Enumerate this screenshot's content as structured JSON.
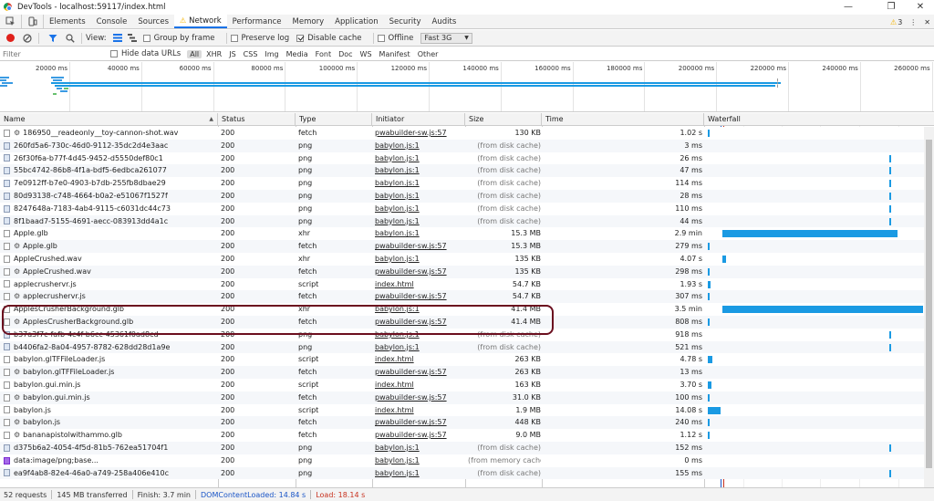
{
  "window": {
    "title": "DevTools - localhost:59117/index.html",
    "controls": [
      "—",
      "❐",
      "✕"
    ]
  },
  "tabs": [
    "Elements",
    "Console",
    "Sources",
    "Network",
    "Performance",
    "Memory",
    "Application",
    "Security",
    "Audits"
  ],
  "active_tab": "Network",
  "issues_count": "3",
  "toolbar": {
    "view_label": "View:",
    "group_by_frame": "Group by frame",
    "preserve_log": "Preserve log",
    "disable_cache": "Disable cache",
    "offline": "Offline",
    "throttle": "Fast 3G"
  },
  "filter": {
    "placeholder": "Filter",
    "hide_data_urls": "Hide data URLs",
    "types": [
      "All",
      "XHR",
      "JS",
      "CSS",
      "Img",
      "Media",
      "Font",
      "Doc",
      "WS",
      "Manifest",
      "Other"
    ]
  },
  "overview_ticks": [
    "20000 ms",
    "40000 ms",
    "60000 ms",
    "80000 ms",
    "100000 ms",
    "120000 ms",
    "140000 ms",
    "160000 ms",
    "180000 ms",
    "200000 ms",
    "220000 ms",
    "240000 ms",
    "260000 ms"
  ],
  "columns": {
    "name": "Name",
    "status": "Status",
    "type": "Type",
    "initiator": "Initiator",
    "size": "Size",
    "time": "Time",
    "waterfall": "Waterfall"
  },
  "rows": [
    {
      "name": "186950__readeonly__toy-cannon-shot.wav",
      "sw": true,
      "icon": "doc",
      "status": "200",
      "type": "fetch",
      "initiator": "pwabuilder-sw.js:57",
      "size": "130 KB",
      "time": "1.02 s"
    },
    {
      "name": "260fd5a6-730c-46d0-9112-35dc2d4e3aac",
      "sw": false,
      "icon": "img",
      "status": "200",
      "type": "png",
      "initiator": "babylon.js:1",
      "size": "(from disk cache)",
      "time": "3 ms"
    },
    {
      "name": "26f30f6a-b77f-4d45-9452-d5550def80c1",
      "sw": false,
      "icon": "img",
      "status": "200",
      "type": "png",
      "initiator": "babylon.js:1",
      "size": "(from disk cache)",
      "time": "26 ms"
    },
    {
      "name": "55bc4742-86b8-4f1a-bdf5-6edbca261077",
      "sw": false,
      "icon": "img",
      "status": "200",
      "type": "png",
      "initiator": "babylon.js:1",
      "size": "(from disk cache)",
      "time": "47 ms"
    },
    {
      "name": "7e0912ff-b7e0-4903-b7db-255fb8dbae29",
      "sw": false,
      "icon": "img",
      "status": "200",
      "type": "png",
      "initiator": "babylon.js:1",
      "size": "(from disk cache)",
      "time": "114 ms"
    },
    {
      "name": "80d93138-c748-4664-b0a2-e51067f1527f",
      "sw": false,
      "icon": "img",
      "status": "200",
      "type": "png",
      "initiator": "babylon.js:1",
      "size": "(from disk cache)",
      "time": "28 ms"
    },
    {
      "name": "8247648a-7183-4ab4-9115-c6031dc44c73",
      "sw": false,
      "icon": "img",
      "status": "200",
      "type": "png",
      "initiator": "babylon.js:1",
      "size": "(from disk cache)",
      "time": "110 ms"
    },
    {
      "name": "8f1baad7-5155-4691-aecc-083913dd4a1c",
      "sw": false,
      "icon": "img",
      "status": "200",
      "type": "png",
      "initiator": "babylon.js:1",
      "size": "(from disk cache)",
      "time": "44 ms"
    },
    {
      "name": "Apple.glb",
      "sw": false,
      "icon": "doc",
      "status": "200",
      "type": "xhr",
      "initiator": "babylon.js:1",
      "size": "15.3 MB",
      "time": "2.9 min"
    },
    {
      "name": "Apple.glb",
      "sw": true,
      "icon": "doc",
      "status": "200",
      "type": "fetch",
      "initiator": "pwabuilder-sw.js:57",
      "size": "15.3 MB",
      "time": "279 ms"
    },
    {
      "name": "AppleCrushed.wav",
      "sw": false,
      "icon": "doc",
      "status": "200",
      "type": "xhr",
      "initiator": "babylon.js:1",
      "size": "135 KB",
      "time": "4.07 s"
    },
    {
      "name": "AppleCrushed.wav",
      "sw": true,
      "icon": "doc",
      "status": "200",
      "type": "fetch",
      "initiator": "pwabuilder-sw.js:57",
      "size": "135 KB",
      "time": "298 ms"
    },
    {
      "name": "applecrushervr.js",
      "sw": false,
      "icon": "doc",
      "status": "200",
      "type": "script",
      "initiator": "index.html",
      "size": "54.7 KB",
      "time": "1.93 s"
    },
    {
      "name": "applecrushervr.js",
      "sw": true,
      "icon": "doc",
      "status": "200",
      "type": "fetch",
      "initiator": "pwabuilder-sw.js:57",
      "size": "54.7 KB",
      "time": "307 ms"
    },
    {
      "name": "ApplesCrusherBackground.glb",
      "sw": false,
      "icon": "doc",
      "status": "200",
      "type": "xhr",
      "initiator": "babylon.js:1",
      "size": "41.4 MB",
      "time": "3.5 min"
    },
    {
      "name": "ApplesCrusherBackground.glb",
      "sw": true,
      "icon": "doc",
      "status": "200",
      "type": "fetch",
      "initiator": "pwabuilder-sw.js:57",
      "size": "41.4 MB",
      "time": "808 ms"
    },
    {
      "name": "b37a3f7c-fafb-4c4f-b6cc-45361f0ad8cd",
      "sw": false,
      "icon": "img",
      "status": "200",
      "type": "png",
      "initiator": "babylon.js:1",
      "size": "(from disk cache)",
      "time": "918 ms"
    },
    {
      "name": "b4406fa2-8a04-4957-8782-628dd28d1a9e",
      "sw": false,
      "icon": "img",
      "status": "200",
      "type": "png",
      "initiator": "babylon.js:1",
      "size": "(from disk cache)",
      "time": "521 ms"
    },
    {
      "name": "babylon.glTFFileLoader.js",
      "sw": false,
      "icon": "doc",
      "status": "200",
      "type": "script",
      "initiator": "index.html",
      "size": "263 KB",
      "time": "4.78 s"
    },
    {
      "name": "babylon.glTFFileLoader.js",
      "sw": true,
      "icon": "doc",
      "status": "200",
      "type": "fetch",
      "initiator": "pwabuilder-sw.js:57",
      "size": "263 KB",
      "time": "13 ms"
    },
    {
      "name": "babylon.gui.min.js",
      "sw": false,
      "icon": "doc",
      "status": "200",
      "type": "script",
      "initiator": "index.html",
      "size": "163 KB",
      "time": "3.70 s"
    },
    {
      "name": "babylon.gui.min.js",
      "sw": true,
      "icon": "doc",
      "status": "200",
      "type": "fetch",
      "initiator": "pwabuilder-sw.js:57",
      "size": "31.0 KB",
      "time": "100 ms"
    },
    {
      "name": "babylon.js",
      "sw": false,
      "icon": "doc",
      "status": "200",
      "type": "script",
      "initiator": "index.html",
      "size": "1.9 MB",
      "time": "14.08 s"
    },
    {
      "name": "babylon.js",
      "sw": true,
      "icon": "doc",
      "status": "200",
      "type": "fetch",
      "initiator": "pwabuilder-sw.js:57",
      "size": "448 KB",
      "time": "240 ms"
    },
    {
      "name": "bananapistolwithammo.glb",
      "sw": true,
      "icon": "doc",
      "status": "200",
      "type": "fetch",
      "initiator": "pwabuilder-sw.js:57",
      "size": "9.0 MB",
      "time": "1.12 s"
    },
    {
      "name": "d375b6a2-4054-4f5d-81b5-762ea51704f1",
      "sw": false,
      "icon": "img",
      "status": "200",
      "type": "png",
      "initiator": "babylon.js:1",
      "size": "(from disk cache)",
      "time": "152 ms"
    },
    {
      "name": "data:image/png;base...",
      "sw": false,
      "icon": "data",
      "status": "200",
      "type": "png",
      "initiator": "babylon.js:1",
      "size": "(from memory cache)",
      "time": "0 ms"
    },
    {
      "name": "ea9f4ab8-82e4-46a0-a749-258a406e410c",
      "sw": false,
      "icon": "img",
      "status": "200",
      "type": "png",
      "initiator": "babylon.js:1",
      "size": "(from disk cache)",
      "time": "155 ms"
    }
  ],
  "statusbar": {
    "requests": "52 requests",
    "transferred": "145 MB transferred",
    "finish": "Finish: 3.7 min",
    "dom_content_loaded": "DOMContentLoaded: 14.84 s",
    "load": "Load: 18.14 s"
  },
  "colors": {
    "accent": "#1a73e8",
    "waterfall_bar": "#1a9ae3",
    "highlight": "#6b0f1f",
    "dcl_line": "#1a55c7",
    "load_line": "#c8321f"
  }
}
